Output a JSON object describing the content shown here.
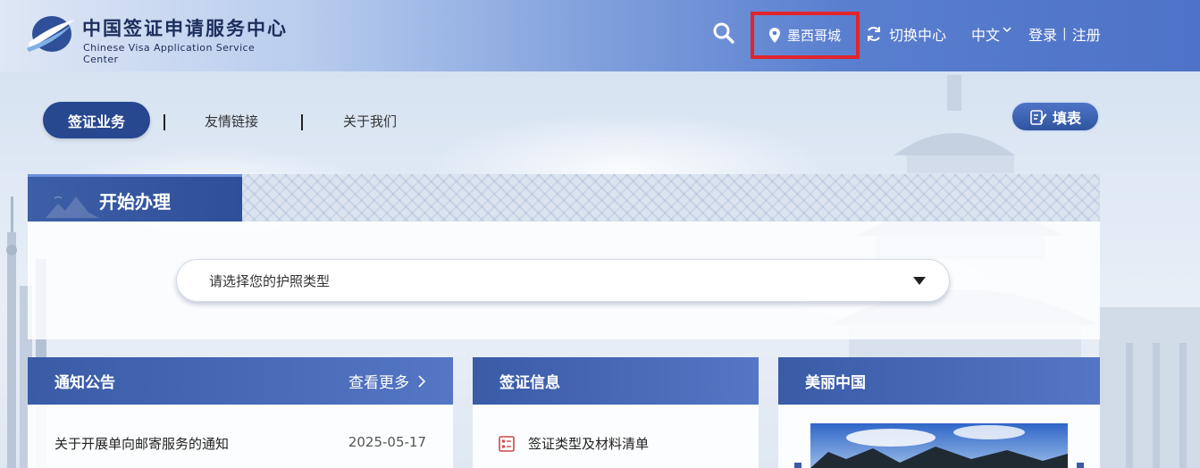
{
  "header": {
    "logo_cn": "中国签证申请服务中心",
    "logo_en": "Chinese Visa Application Service Center",
    "city": "墨西哥城",
    "switch_center": "切换中心",
    "language": "中文",
    "login": "登录",
    "register": "注册",
    "auth_separator": "|"
  },
  "nav": {
    "items": [
      {
        "label": "签证业务"
      },
      {
        "label": "友情链接"
      },
      {
        "label": "关于我们"
      }
    ],
    "fill_form": "填表"
  },
  "start_panel": {
    "title": "开始办理",
    "passport_placeholder": "请选择您的护照类型"
  },
  "cards": {
    "notice": {
      "title": "通知公告",
      "more": "查看更多",
      "items": [
        {
          "title": "关于开展单向邮寄服务的通知",
          "date": "2025-05-17"
        }
      ]
    },
    "visa_info": {
      "title": "签证信息",
      "items": [
        {
          "title": "签证类型及材料清单"
        }
      ]
    },
    "beautiful_china": {
      "title": "美丽中国"
    }
  },
  "colors": {
    "header_blue": "#4d72c7",
    "nav_active": "#27478f",
    "highlight_red": "#e0252b",
    "card_head": "#3a5ba6"
  }
}
